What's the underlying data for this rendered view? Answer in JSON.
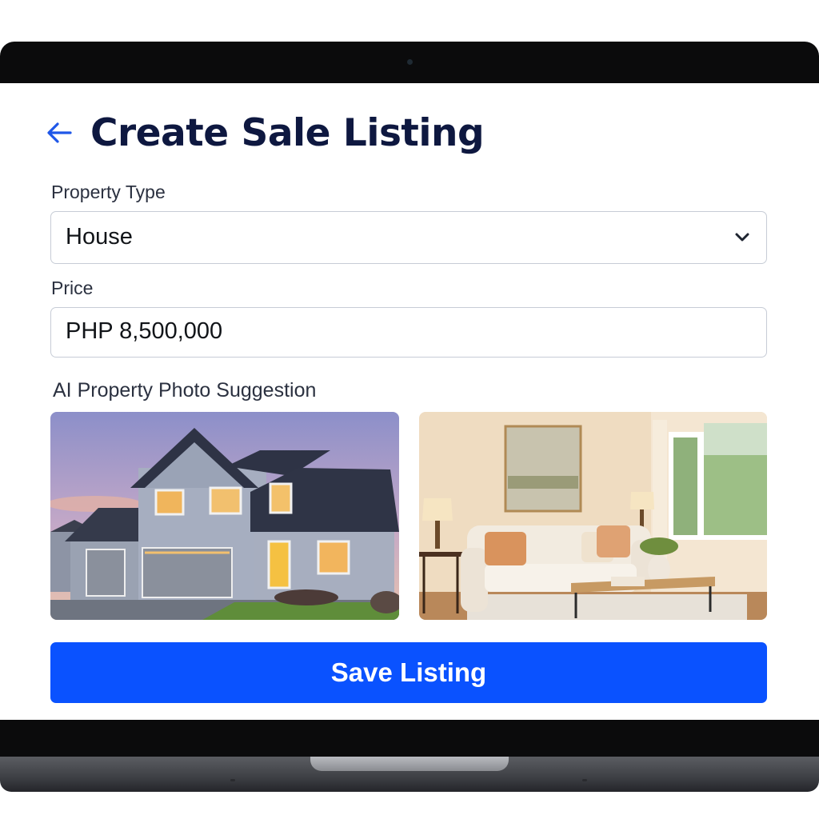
{
  "header": {
    "title": "Create Sale Listing",
    "back_icon": "arrow-left-icon"
  },
  "form": {
    "property_type": {
      "label": "Property Type",
      "value": "House",
      "icon": "chevron-down-icon"
    },
    "price": {
      "label": "Price",
      "value": "PHP 8,500,000"
    },
    "photos": {
      "label": "AI Property Photo Suggestion"
    },
    "save_label": "Save Listing"
  },
  "colors": {
    "accent": "#0a52ff",
    "title": "#0e1840",
    "field_border": "#c7ccd6"
  }
}
